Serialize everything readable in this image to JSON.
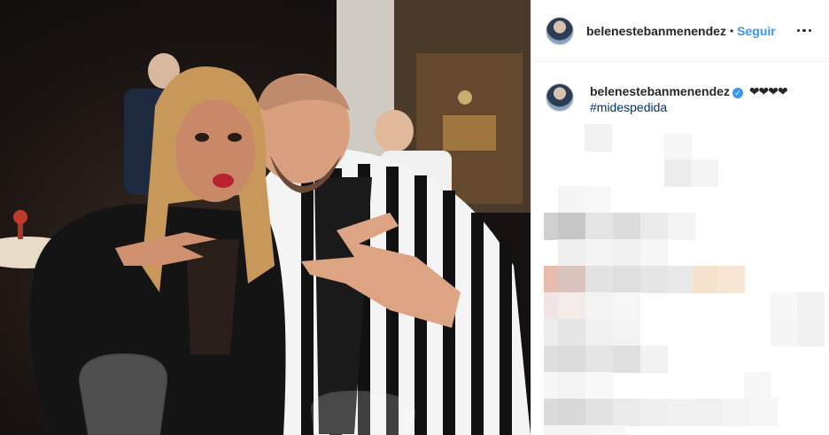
{
  "post": {
    "username": "belenestebanmenendez",
    "separator": "•",
    "follow_label": "Seguir",
    "more_icon": "more-horizontal-icon"
  },
  "caption": {
    "username": "belenestebanmenendez",
    "verified_icon": "verified-badge-icon",
    "verified_glyph": "✓",
    "text": "❤❤❤❤",
    "hashtag": "#midespedida"
  },
  "colors": {
    "accent": "#3897f0",
    "hashtag": "#003569",
    "text": "#262626",
    "border": "#efefef"
  }
}
